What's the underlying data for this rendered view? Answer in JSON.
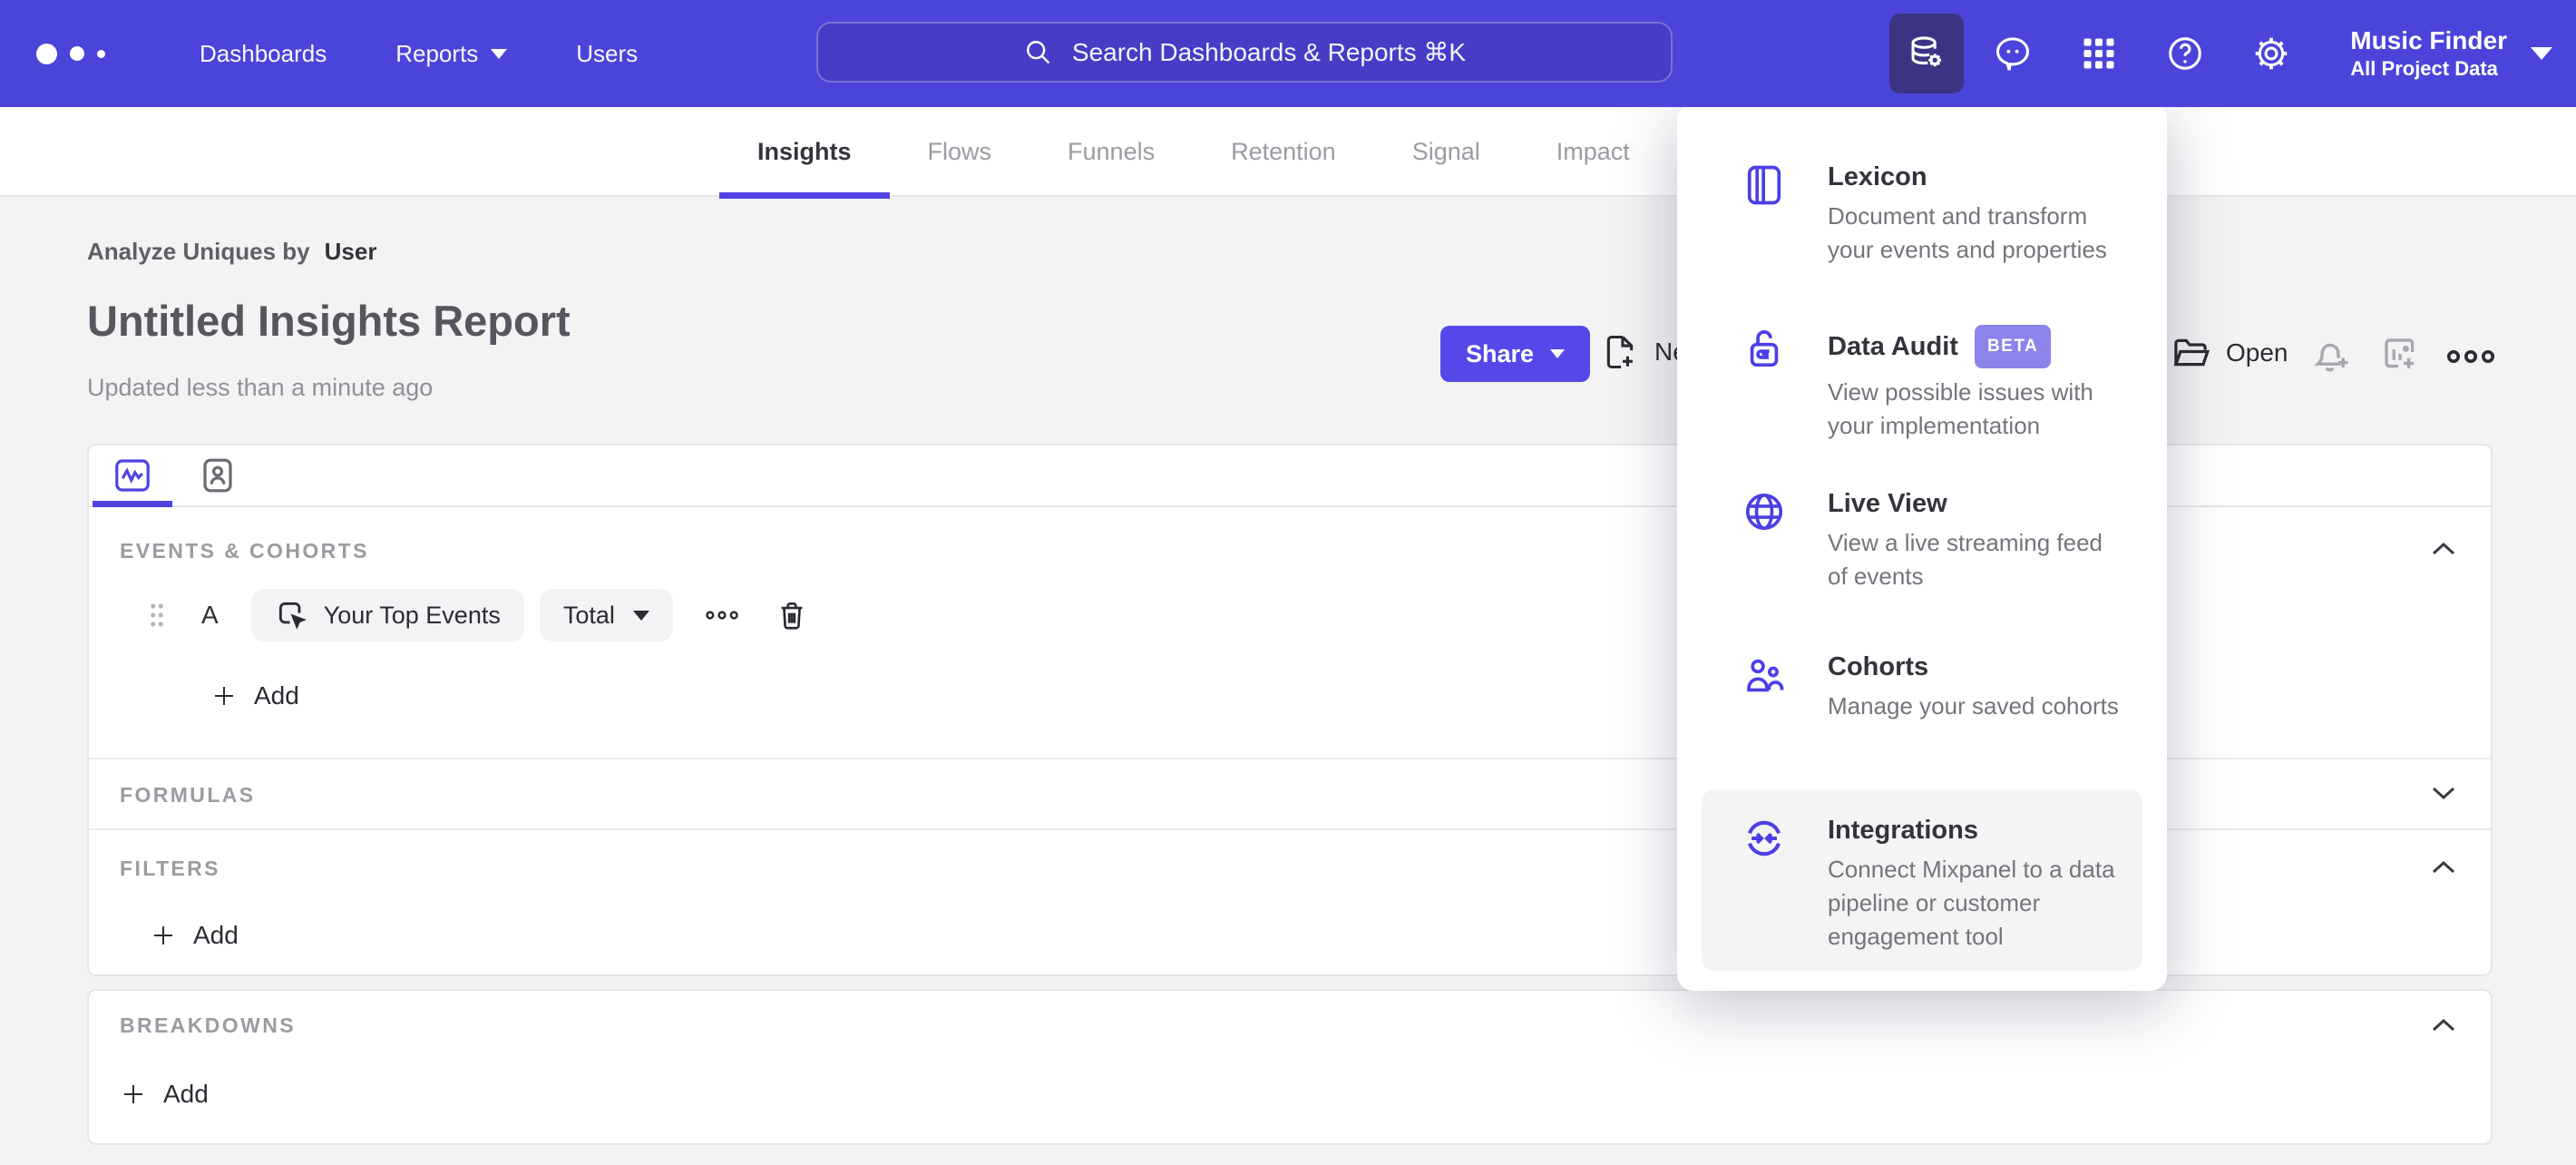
{
  "nav": {
    "items": [
      {
        "label": "Dashboards"
      },
      {
        "label": "Reports"
      },
      {
        "label": "Users"
      }
    ],
    "search_placeholder": "Search Dashboards & Reports ⌘K",
    "project": {
      "name": "Music Finder",
      "scope": "All Project Data"
    }
  },
  "tabs": [
    {
      "label": "Insights"
    },
    {
      "label": "Flows"
    },
    {
      "label": "Funnels"
    },
    {
      "label": "Retention"
    },
    {
      "label": "Signal"
    },
    {
      "label": "Impact"
    }
  ],
  "report": {
    "breadcrumb_prefix": "Analyze Uniques by",
    "breadcrumb_value": "User",
    "title": "Untitled Insights Report",
    "updated": "Updated less than a minute ago",
    "share_label": "Share",
    "new_label": "New",
    "open_label": "Open"
  },
  "builder": {
    "events_label": "EVENTS & COHORTS",
    "series_letter": "A",
    "event_name": "Your Top Events",
    "aggregation": "Total",
    "add_label": "Add",
    "formulas_label": "FORMULAS",
    "filters_label": "FILTERS",
    "breakdowns_label": "BREAKDOWNS"
  },
  "menu": {
    "items": [
      {
        "title": "Lexicon",
        "desc": "Document and transform your events and properties"
      },
      {
        "title": "Data Audit",
        "badge": "BETA",
        "desc": "View possible issues with your implementation"
      },
      {
        "title": "Live View",
        "desc": "View a live streaming feed of events"
      },
      {
        "title": "Cohorts",
        "desc": "Manage your saved cohorts"
      },
      {
        "title": "Integrations",
        "desc": "Connect Mixpanel to a data pipeline or customer engagement tool"
      }
    ]
  },
  "colors": {
    "nav_background": "#4b44da",
    "nav_active_item": "#3a3482",
    "accent_purple": "#4f44e0",
    "share_button": "#5448e8",
    "beta_badge": "#8c84eb",
    "page_background": "#f3f3f4"
  }
}
